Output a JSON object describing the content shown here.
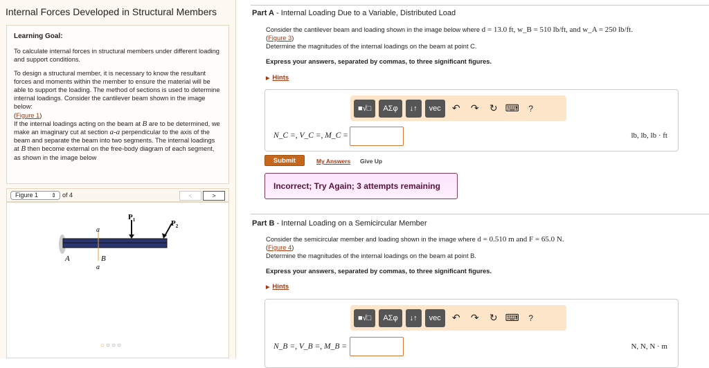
{
  "left": {
    "title": "Internal Forces Developed in Structural Members",
    "goal_heading": "Learning Goal:",
    "goal_text": "To calculate internal forces in structural members under different loading and support conditions.",
    "para1": "To design a structural member, it is necessary to know the resultant forces and moments within the member to ensure the material will be able to support the loading. The method of sections is used to determine internal loadings. Consider the cantilever beam shown in the image below:",
    "figure1_link": "Figure 1",
    "para2a": "If the internal loadings acting on the beam at ",
    "B": "B",
    "para2b": " are to be determined, we make an imaginary cut at section ",
    "aa": "a-a",
    "para2c": " perpendicular to the axis of the beam and separate the beam into two segments. The internal loadings at ",
    "para2d": " then become external on the free-body diagram of each segment, as shown in the image below",
    "figure_select": "Figure 1",
    "of_label": "of 4",
    "prev": "<",
    "next": ">",
    "fig_labels": {
      "P1": "P",
      "P1sub": "1",
      "P2": "P",
      "P2sub": "2",
      "a": "a",
      "A": "A",
      "B": "B"
    }
  },
  "partA": {
    "label": "Part A",
    "title": " - Internal Loading Due to a Variable, Distributed Load",
    "intro": "Consider the cantilever beam and loading shown in the image below where ",
    "given": "d = 13.0 ft, w_B = 510 lb/ft, and w_A = 250 lb/ft.",
    "figure_link": "Figure 3",
    "determine": "Determine the magnitudes of the internal loadings on the beam at point C.",
    "express": "Express your answers, separated by commas, to three significant figures.",
    "hints": "Hints",
    "equation": "N_C =, V_C =, M_C =",
    "input_value": "",
    "units": "lb, lb, lb · ft",
    "submit": "Submit",
    "my_answers": "My Answers",
    "give_up": "Give Up",
    "feedback": "Incorrect; Try Again; 3 attempts remaining"
  },
  "partB": {
    "label": "Part B",
    "title": " - Internal Loading on a Semicircular Member",
    "intro": "Consider the semicircular member and loading shown in the image where ",
    "given": "d = 0.510 m and F = 65.0 N.",
    "figure_link": "Figure 4",
    "determine": "Determine the magnitudes of the internal loadings on the beam at point B.",
    "express": "Express your answers, separated by commas, to three significant figures.",
    "hints": "Hints",
    "equation": "N_B =, V_B =, M_B =",
    "input_value": "",
    "units": "N, N, N · m"
  },
  "toolbar": {
    "templates": "■√□",
    "greek": "ΑΣφ",
    "arrows": "↓↑",
    "vec": "vec",
    "undo": "↶",
    "redo": "↷",
    "reset": "↻",
    "keyboard": "⌨",
    "help": "?"
  }
}
